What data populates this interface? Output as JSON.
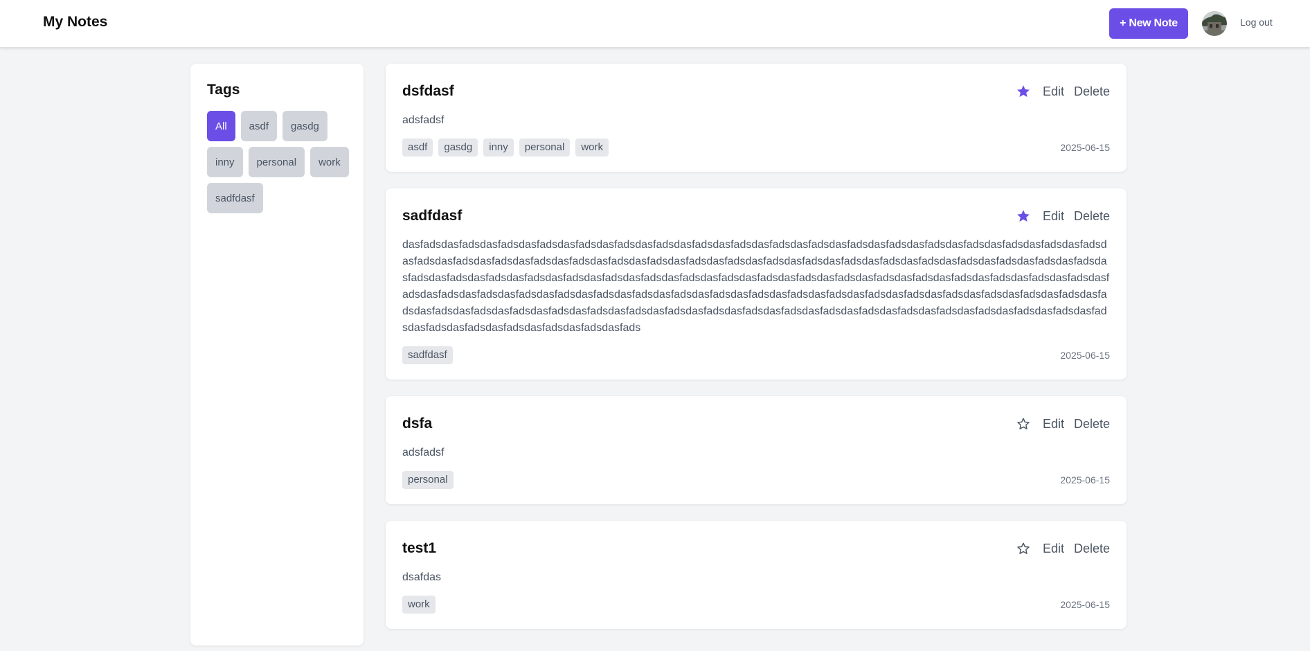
{
  "app": {
    "title": "My Notes",
    "new_note_label": "+ New Note",
    "logout_label": "Log out"
  },
  "sidebar": {
    "title": "Tags",
    "tags": [
      {
        "label": "All",
        "active": true
      },
      {
        "label": "asdf",
        "active": false
      },
      {
        "label": "gasdg",
        "active": false
      },
      {
        "label": "inny",
        "active": false
      },
      {
        "label": "personal",
        "active": false
      },
      {
        "label": "work",
        "active": false
      },
      {
        "label": "sadfdasf",
        "active": false
      }
    ]
  },
  "notes": [
    {
      "title": "dsfdasf",
      "favorite": true,
      "content": "adsfadsf",
      "tags": [
        "asdf",
        "gasdg",
        "inny",
        "personal",
        "work"
      ],
      "date": "2025-06-15"
    },
    {
      "title": "sadfdasf",
      "favorite": true,
      "content": "dasfadsdasfadsdasfadsdasfadsdasfadsdasfadsdasfadsdasfadsdasfadsdasfadsdasfadsdasfadsdasfadsdasfadsdasfadsdasfadsdasfadsdasfadsdasfadsdasfadsdasfadsdasfadsdasfadsdasfadsdasfadsdasfadsdasfadsdasfadsdasfadsdasfadsdasfadsdasfadsdasfadsdasfadsdasfadsdasfadsdasfadsdasfadsdasfadsdasfadsdasfadsdasfadsdasfadsdasfadsdasfadsdasfadsdasfadsdasfadsdasfadsdasfadsdasfadsdasfadsdasfadsdasfadsdasfadsdasfadsdasfadsdasfadsdasfadsdasfadsdasfadsdasfadsdasfadsdasfadsdasfadsdasfadsdasfadsdasfadsdasfadsdasfadsdasfadsdasfadsdasfadsdasfadsdasfadsdasfadsdasfadsdasfadsdasfadsdasfadsdasfadsdasfadsdasfadsdasfadsdasfadsdasfadsdasfadsdasfadsdasfadsdasfadsdasfadsdasfadsdasfadsdasfadsdasfadsdasfadsdasfads",
      "tags": [
        "sadfdasf"
      ],
      "date": "2025-06-15"
    },
    {
      "title": "dsfa",
      "favorite": false,
      "content": "adsfadsf",
      "tags": [
        "personal"
      ],
      "date": "2025-06-15"
    },
    {
      "title": "test1",
      "favorite": false,
      "content": "dsafdas",
      "tags": [
        "work"
      ],
      "date": "2025-06-15"
    }
  ],
  "labels": {
    "edit": "Edit",
    "delete": "Delete"
  },
  "colors": {
    "accent": "#6b4ee6",
    "background": "#f3f4f6",
    "tag_bg": "#d1d5db",
    "note_tag_bg": "#e5e7eb",
    "text_muted": "#4b5563"
  },
  "icons": {
    "favorite_on": "star-filled-icon",
    "favorite_off": "star-outline-icon"
  }
}
